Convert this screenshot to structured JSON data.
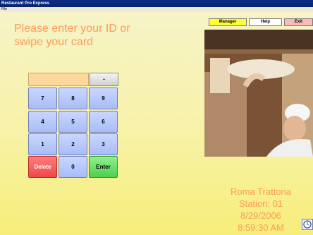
{
  "window": {
    "title": "Restaurant Pro Express"
  },
  "menu": {
    "file": "File"
  },
  "prompt": {
    "line1": "Please enter your ID or",
    "line2": "swipe your card"
  },
  "top_buttons": {
    "manager": "Manager",
    "help": "Help",
    "exit": "Exit"
  },
  "keypad": {
    "entry_value": "",
    "dot": "-",
    "rows": [
      [
        "7",
        "8",
        "9"
      ],
      [
        "4",
        "5",
        "6"
      ],
      [
        "1",
        "2",
        "3"
      ],
      [
        "Delete",
        "0",
        "Enter"
      ]
    ]
  },
  "info": {
    "restaurant": "Roma Trattoria",
    "station": "Station: 01",
    "date": "8/29/2006",
    "time": "8:59:30 AM"
  },
  "colors": {
    "prompt_text": "#ff9a5a",
    "manager_btn": "#ffff33",
    "exit_btn": "#ffb8b8",
    "key_blue": "#b9c9fb",
    "delete_red": "#f04848",
    "enter_green": "#4fcf4f"
  }
}
